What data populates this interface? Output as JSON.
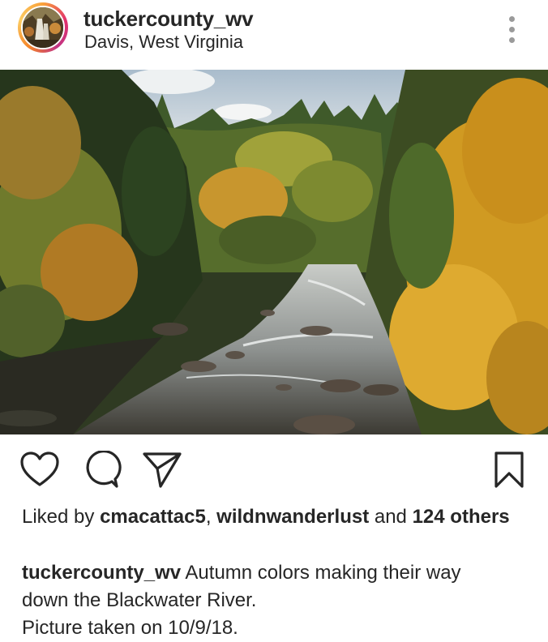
{
  "post": {
    "username": "tuckercounty_wv",
    "location": "Davis, West Virginia",
    "likes": {
      "prefix": "Liked by ",
      "user1": "cmacattac5",
      "separator": ", ",
      "user2": "wildnwanderlust",
      "and_text": " and ",
      "others": "124 others"
    },
    "caption": {
      "username": "tuckercounty_wv",
      "line1": " Autumn colors making their way",
      "line2": "down the Blackwater River.",
      "line3": "Picture taken on 10/9/18."
    }
  },
  "icons": {
    "more": "more-options-icon",
    "like": "heart-icon",
    "comment": "comment-icon",
    "share": "send-icon",
    "save": "bookmark-icon"
  },
  "colors": {
    "text": "#262626",
    "story_ring": "#e1306c",
    "dots": "#9a9a9a"
  }
}
